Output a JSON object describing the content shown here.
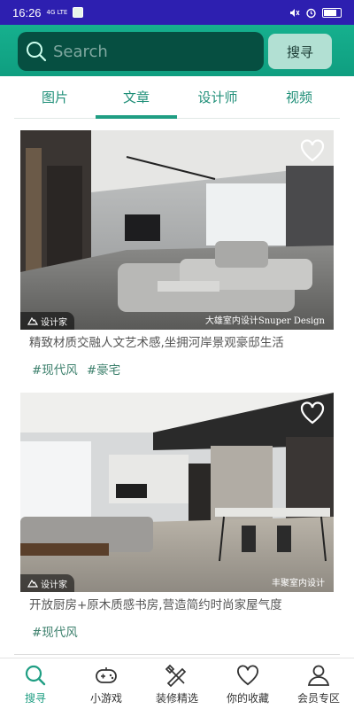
{
  "status_bar": {
    "time": "16:26",
    "net": "4G LTE"
  },
  "search": {
    "placeholder": "Search",
    "button_label": "搜寻"
  },
  "tabs": [
    {
      "label": "图片",
      "active": false
    },
    {
      "label": "文章",
      "active": true
    },
    {
      "label": "设计师",
      "active": false
    },
    {
      "label": "视频",
      "active": false
    }
  ],
  "cards": [
    {
      "brand": "设计家",
      "designer": "大雄室内设计Snuper Design",
      "title": "精致材质交融人文艺术感,坐拥河岸景观豪邸生活",
      "tags": [
        "#现代风",
        "#豪宅"
      ]
    },
    {
      "brand": "设计家",
      "designer": "丰聚室内设计",
      "title": "开放厨房+原木质感书房,营造简约时尚家屋气度",
      "tags": [
        "#现代风"
      ]
    }
  ],
  "bottom_nav": [
    {
      "label": "搜寻",
      "icon": "search-icon",
      "active": true
    },
    {
      "label": "小游戏",
      "icon": "gamepad-icon",
      "active": false
    },
    {
      "label": "装修精选",
      "icon": "tools-icon",
      "active": false
    },
    {
      "label": "你的收藏",
      "icon": "heart-icon",
      "active": false
    },
    {
      "label": "会员专区",
      "icon": "user-icon",
      "active": false
    }
  ],
  "colors": {
    "accent": "#1f9e83",
    "header": "#16b08e",
    "search_bg": "#064f41",
    "status_bar": "#2d1fb0"
  }
}
